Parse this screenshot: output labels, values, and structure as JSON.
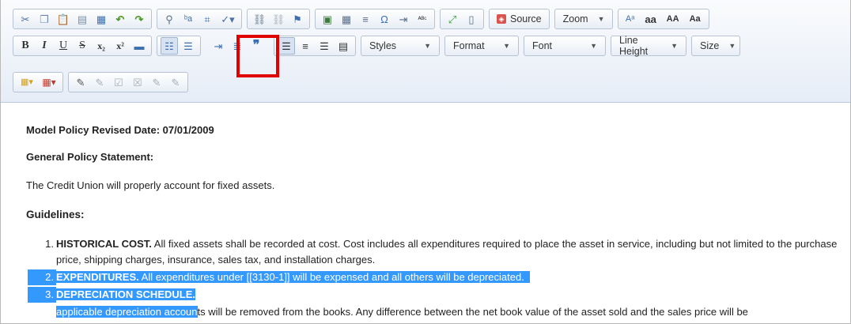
{
  "toolbar": {
    "row1_group1": [
      "cut-icon",
      "copy-icon",
      "paste-icon",
      "paste-text-icon",
      "paste-word-icon",
      "undo-icon",
      "redo-icon"
    ],
    "row1_group2": [
      "find-icon",
      "replace-icon",
      "select-all-icon",
      "spellcheck-icon"
    ],
    "row1_group3": [
      "link-icon",
      "unlink-icon",
      "anchor-icon"
    ],
    "row1_group4": [
      "image-icon",
      "table-icon",
      "horizontal-line-icon",
      "special-char-icon",
      "page-break-icon",
      "spell-abc-icon"
    ],
    "row1_group5": [
      "maximize-icon",
      "show-blocks-icon"
    ],
    "source_label": "Source",
    "zoom_label": "Zoom",
    "case_labels": [
      "aa",
      "AA",
      "Aa"
    ],
    "styles_label": "Styles",
    "format_label": "Format",
    "font_label": "Font",
    "line_height_label": "Line Height",
    "size_label": "Size",
    "bold": "B",
    "italic": "I",
    "underline": "U",
    "strike": "S"
  },
  "content": {
    "revised": "Model Policy Revised Date: 07/01/2009",
    "general_heading": "General Policy Statement:",
    "credit_text": "The Credit Union will properly account for fixed assets.",
    "guidelines_heading": "Guidelines:",
    "items": [
      {
        "num": "1.",
        "bold": "HISTORICAL COST.",
        "text": " All fixed assets shall be recorded at cost. Cost includes all expenditures required to place the asset in service, including but not limited to the purchase price, shipping charges, insurance, sales tax, and installation charges."
      },
      {
        "num": "2.",
        "bold": "EXPENDITURES.",
        "text": " All expenditures under [[3130-1]] will be expensed and all others will be depreciated."
      },
      {
        "num": "3.",
        "bold": "DEPRECIATION SCHEDULE.",
        "sel_text": "applicable depreciation accoun",
        "text": "ts will be removed from the books. Any difference between the net book value of the asset sold and the sales price will be"
      }
    ]
  },
  "colors": {
    "selection": "#3399ff",
    "highlight_box": "#e00000"
  }
}
